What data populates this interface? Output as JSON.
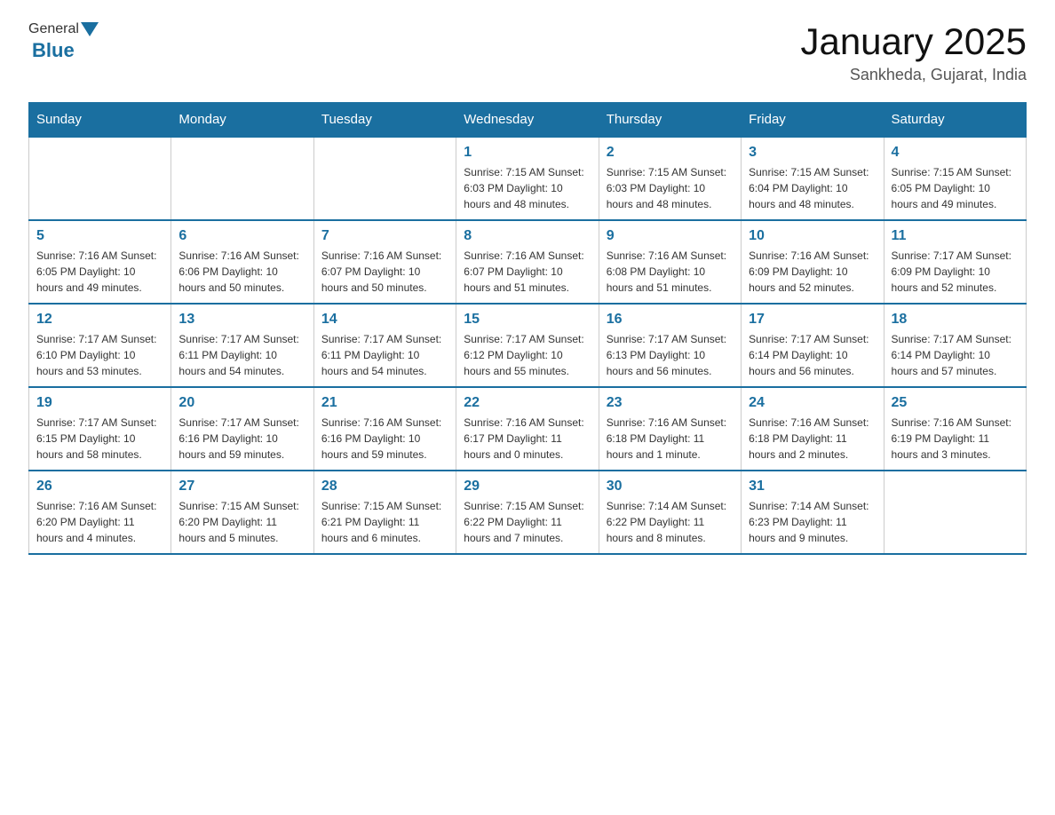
{
  "header": {
    "logo_text_general": "General",
    "logo_text_blue": "Blue",
    "month_title": "January 2025",
    "location": "Sankheda, Gujarat, India"
  },
  "days_of_week": [
    "Sunday",
    "Monday",
    "Tuesday",
    "Wednesday",
    "Thursday",
    "Friday",
    "Saturday"
  ],
  "weeks": [
    [
      {
        "day": "",
        "info": ""
      },
      {
        "day": "",
        "info": ""
      },
      {
        "day": "",
        "info": ""
      },
      {
        "day": "1",
        "info": "Sunrise: 7:15 AM\nSunset: 6:03 PM\nDaylight: 10 hours\nand 48 minutes."
      },
      {
        "day": "2",
        "info": "Sunrise: 7:15 AM\nSunset: 6:03 PM\nDaylight: 10 hours\nand 48 minutes."
      },
      {
        "day": "3",
        "info": "Sunrise: 7:15 AM\nSunset: 6:04 PM\nDaylight: 10 hours\nand 48 minutes."
      },
      {
        "day": "4",
        "info": "Sunrise: 7:15 AM\nSunset: 6:05 PM\nDaylight: 10 hours\nand 49 minutes."
      }
    ],
    [
      {
        "day": "5",
        "info": "Sunrise: 7:16 AM\nSunset: 6:05 PM\nDaylight: 10 hours\nand 49 minutes."
      },
      {
        "day": "6",
        "info": "Sunrise: 7:16 AM\nSunset: 6:06 PM\nDaylight: 10 hours\nand 50 minutes."
      },
      {
        "day": "7",
        "info": "Sunrise: 7:16 AM\nSunset: 6:07 PM\nDaylight: 10 hours\nand 50 minutes."
      },
      {
        "day": "8",
        "info": "Sunrise: 7:16 AM\nSunset: 6:07 PM\nDaylight: 10 hours\nand 51 minutes."
      },
      {
        "day": "9",
        "info": "Sunrise: 7:16 AM\nSunset: 6:08 PM\nDaylight: 10 hours\nand 51 minutes."
      },
      {
        "day": "10",
        "info": "Sunrise: 7:16 AM\nSunset: 6:09 PM\nDaylight: 10 hours\nand 52 minutes."
      },
      {
        "day": "11",
        "info": "Sunrise: 7:17 AM\nSunset: 6:09 PM\nDaylight: 10 hours\nand 52 minutes."
      }
    ],
    [
      {
        "day": "12",
        "info": "Sunrise: 7:17 AM\nSunset: 6:10 PM\nDaylight: 10 hours\nand 53 minutes."
      },
      {
        "day": "13",
        "info": "Sunrise: 7:17 AM\nSunset: 6:11 PM\nDaylight: 10 hours\nand 54 minutes."
      },
      {
        "day": "14",
        "info": "Sunrise: 7:17 AM\nSunset: 6:11 PM\nDaylight: 10 hours\nand 54 minutes."
      },
      {
        "day": "15",
        "info": "Sunrise: 7:17 AM\nSunset: 6:12 PM\nDaylight: 10 hours\nand 55 minutes."
      },
      {
        "day": "16",
        "info": "Sunrise: 7:17 AM\nSunset: 6:13 PM\nDaylight: 10 hours\nand 56 minutes."
      },
      {
        "day": "17",
        "info": "Sunrise: 7:17 AM\nSunset: 6:14 PM\nDaylight: 10 hours\nand 56 minutes."
      },
      {
        "day": "18",
        "info": "Sunrise: 7:17 AM\nSunset: 6:14 PM\nDaylight: 10 hours\nand 57 minutes."
      }
    ],
    [
      {
        "day": "19",
        "info": "Sunrise: 7:17 AM\nSunset: 6:15 PM\nDaylight: 10 hours\nand 58 minutes."
      },
      {
        "day": "20",
        "info": "Sunrise: 7:17 AM\nSunset: 6:16 PM\nDaylight: 10 hours\nand 59 minutes."
      },
      {
        "day": "21",
        "info": "Sunrise: 7:16 AM\nSunset: 6:16 PM\nDaylight: 10 hours\nand 59 minutes."
      },
      {
        "day": "22",
        "info": "Sunrise: 7:16 AM\nSunset: 6:17 PM\nDaylight: 11 hours\nand 0 minutes."
      },
      {
        "day": "23",
        "info": "Sunrise: 7:16 AM\nSunset: 6:18 PM\nDaylight: 11 hours\nand 1 minute."
      },
      {
        "day": "24",
        "info": "Sunrise: 7:16 AM\nSunset: 6:18 PM\nDaylight: 11 hours\nand 2 minutes."
      },
      {
        "day": "25",
        "info": "Sunrise: 7:16 AM\nSunset: 6:19 PM\nDaylight: 11 hours\nand 3 minutes."
      }
    ],
    [
      {
        "day": "26",
        "info": "Sunrise: 7:16 AM\nSunset: 6:20 PM\nDaylight: 11 hours\nand 4 minutes."
      },
      {
        "day": "27",
        "info": "Sunrise: 7:15 AM\nSunset: 6:20 PM\nDaylight: 11 hours\nand 5 minutes."
      },
      {
        "day": "28",
        "info": "Sunrise: 7:15 AM\nSunset: 6:21 PM\nDaylight: 11 hours\nand 6 minutes."
      },
      {
        "day": "29",
        "info": "Sunrise: 7:15 AM\nSunset: 6:22 PM\nDaylight: 11 hours\nand 7 minutes."
      },
      {
        "day": "30",
        "info": "Sunrise: 7:14 AM\nSunset: 6:22 PM\nDaylight: 11 hours\nand 8 minutes."
      },
      {
        "day": "31",
        "info": "Sunrise: 7:14 AM\nSunset: 6:23 PM\nDaylight: 11 hours\nand 9 minutes."
      },
      {
        "day": "",
        "info": ""
      }
    ]
  ]
}
